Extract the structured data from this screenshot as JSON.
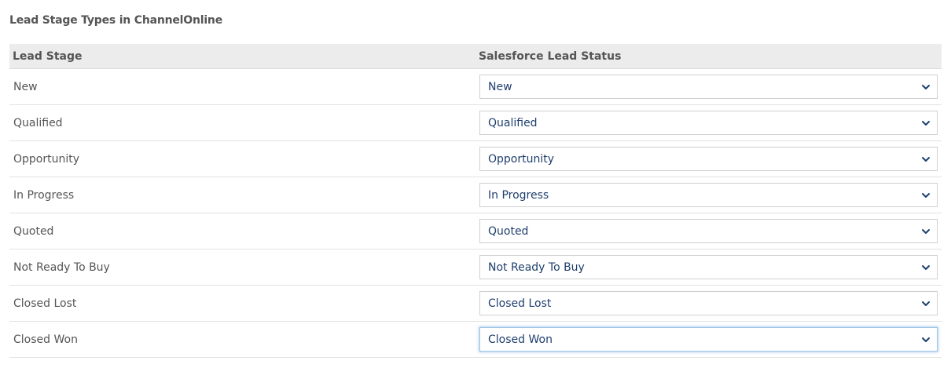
{
  "page": {
    "title": "Lead Stage Types in ChannelOnline"
  },
  "table": {
    "headers": {
      "lead_stage": "Lead Stage",
      "salesforce_status": "Salesforce Lead Status"
    },
    "rows": [
      {
        "stage": "New",
        "status": "New"
      },
      {
        "stage": "Qualified",
        "status": "Qualified"
      },
      {
        "stage": "Opportunity",
        "status": "Opportunity"
      },
      {
        "stage": "In Progress",
        "status": "In Progress"
      },
      {
        "stage": "Quoted",
        "status": "Quoted"
      },
      {
        "stage": "Not Ready To Buy",
        "status": "Not Ready To Buy"
      },
      {
        "stage": "Closed Lost",
        "status": "Closed Lost"
      },
      {
        "stage": "Closed Won",
        "status": "Closed Won"
      }
    ]
  },
  "colors": {
    "header_bg": "#ececec",
    "text": "#555555",
    "select_text": "#1f3f6e",
    "chevron": "#1f3f6e",
    "focus_glow": "#9ec3e6"
  },
  "icons": {
    "dropdown": "chevron-down-icon"
  },
  "state": {
    "focused_row_index": 7
  }
}
